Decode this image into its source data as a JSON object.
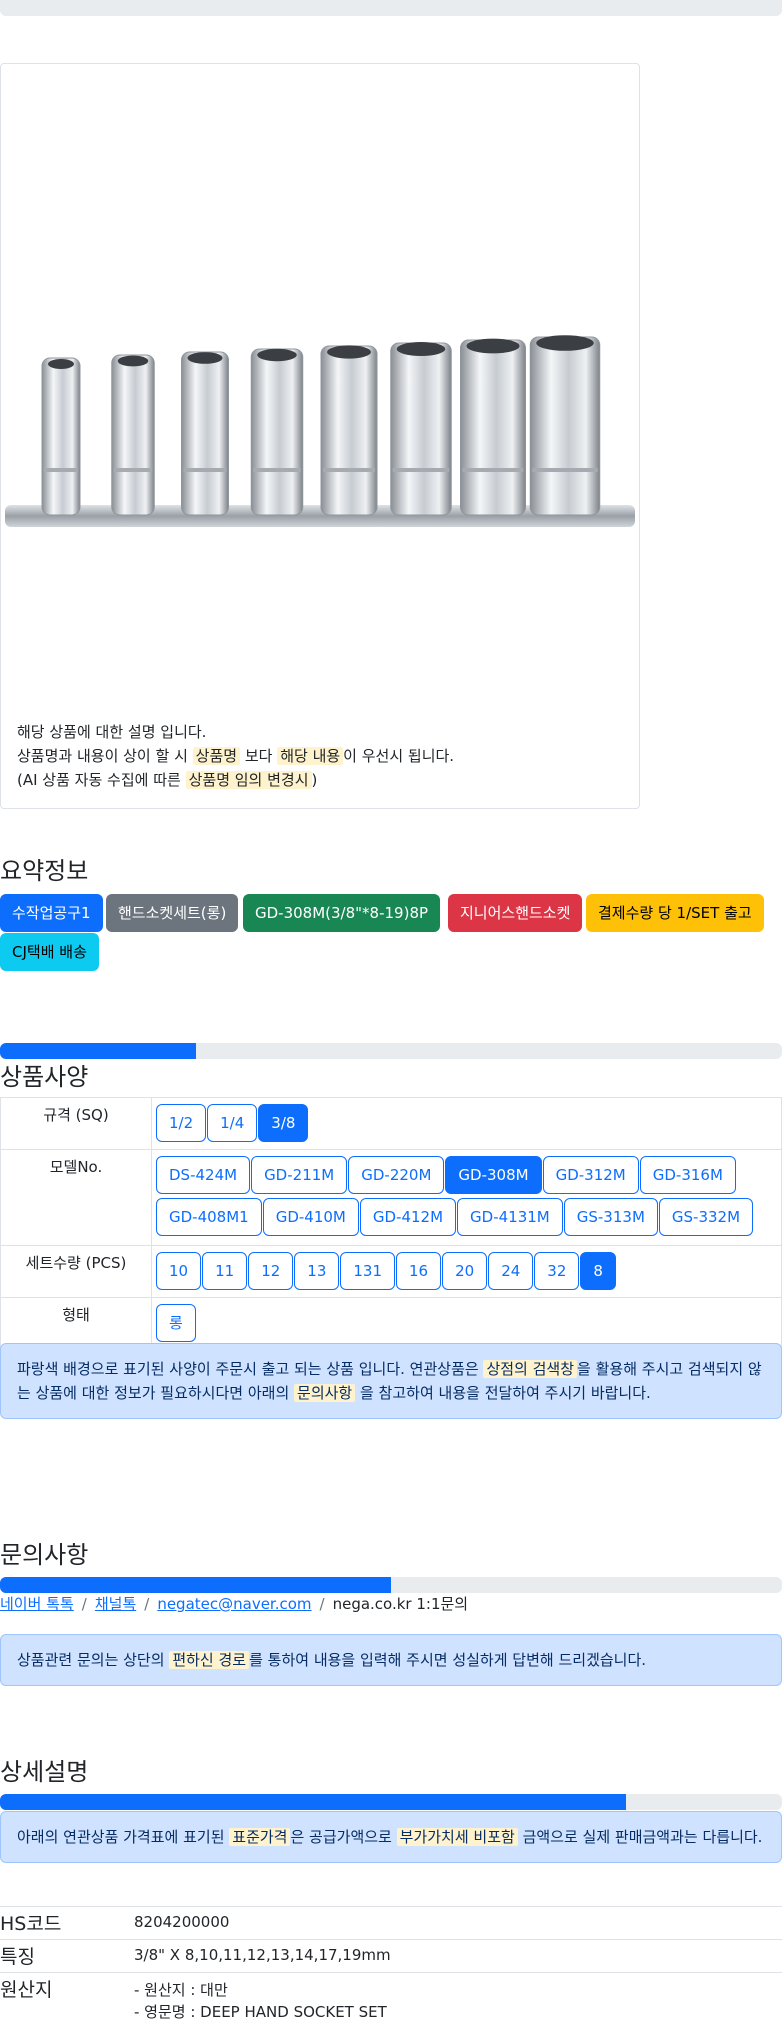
{
  "description": {
    "line1": "해당 상품에 대한 설명 입니다.",
    "line2_a": "상품명과 내용이 상이 할 시 ",
    "line2_hl1": "상품명",
    "line2_b": " 보다 ",
    "line2_hl2": "해당 내용",
    "line2_c": "이 우선시 됩니다.",
    "line3_a": "(AI 상품 자동 수집에 따른 ",
    "line3_hl": "상품명 임의 변경시",
    "line3_b": ")"
  },
  "summary": {
    "title": "요약정보",
    "badges": [
      "수작업공구1",
      "핸드소켓세트(롱)",
      "GD-308M(3/8\"*8-19)8P",
      "지니어스핸드소켓",
      "결제수량 당 1/SET 출고",
      "CJ택배 배송"
    ],
    "badge_colors": [
      "#0d6efd",
      "#6c757d",
      "#198754",
      "#dc3545",
      "#ffc107",
      "#0dcaf0"
    ]
  },
  "spec": {
    "title": "상품사양",
    "progress": 0.25,
    "rows": [
      {
        "label": "규격 (SQ)",
        "options": [
          "1/2",
          "1/4",
          "3/8"
        ],
        "selected": "3/8"
      },
      {
        "label": "모델No.",
        "options": [
          "DS-424M",
          "GD-211M",
          "GD-220M",
          "GD-308M",
          "GD-312M",
          "GD-316M",
          "GD-408M1",
          "GD-410M",
          "GD-412M",
          "GD-4131M",
          "GS-313M",
          "GS-332M"
        ],
        "selected": "GD-308M"
      },
      {
        "label": "세트수량 (PCS)",
        "options": [
          "10",
          "11",
          "12",
          "13",
          "131",
          "16",
          "20",
          "24",
          "32",
          "8"
        ],
        "selected": "8"
      },
      {
        "label": "형태",
        "options": [
          "롱"
        ],
        "selected": ""
      }
    ],
    "notice_a": "파랑색 배경으로 표기된 사양이 주문시 출고 되는 상품 입니다. 연관상품은 ",
    "notice_hl1": "상점의 검색창",
    "notice_b": "을 활용해 주시고 검색되지 않는 상품에 대한 정보가 필요하시다면 아래의 ",
    "notice_hl2": "문의사항",
    "notice_c": " 을 참고하여 내용을 전달하여 주시기 바랍니다."
  },
  "inquiry": {
    "title": "문의사항",
    "progress": 0.5,
    "links": [
      "네이버 톡톡",
      "채널톡",
      "negatec@naver.com"
    ],
    "last": "nega.co.kr 1:1문의",
    "notice_a": "상품관련 문의는 상단의 ",
    "notice_hl": "편하신 경로",
    "notice_b": "를 통하여 내용을 입력해 주시면 성실하게 답변해 드리겠습니다."
  },
  "detail": {
    "title": "상세설명",
    "progress": 0.8,
    "notice_a": "아래의 연관상품 가격표에 표기된 ",
    "notice_hl1": "표준가격",
    "notice_b": "은 공급가액으로 ",
    "notice_hl2": "부가가치세 비포함",
    "notice_c": " 금액으로 실제 판매금액과는 다릅니다."
  },
  "info": {
    "hs_label": "HS코드",
    "hs_value": "8204200000",
    "feature_label": "특징",
    "feature_value": "3/8\" X 8,10,11,12,13,14,17,19mm",
    "origin_label": "원산지",
    "origin_value1": "- 원산지 : 대만",
    "origin_value2": "- 영문명 : DEEP HAND SOCKET SET"
  }
}
